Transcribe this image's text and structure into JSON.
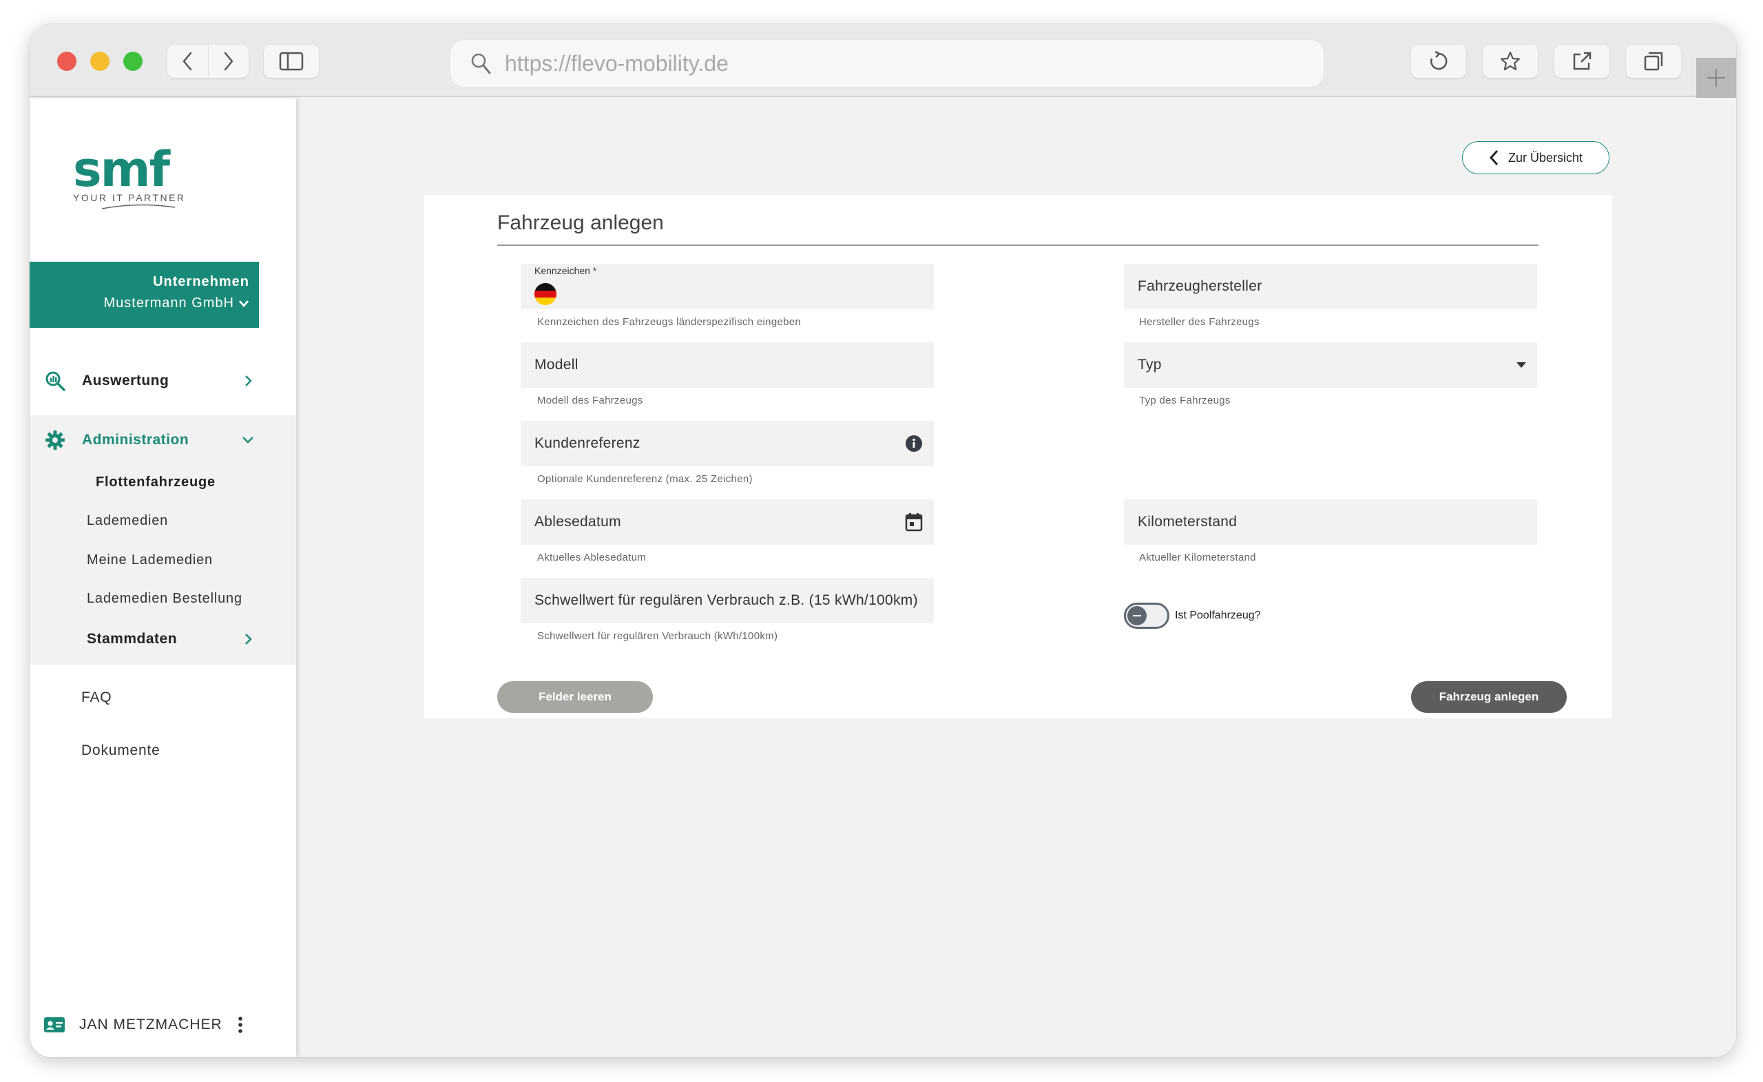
{
  "browser": {
    "url": "https://flevo-mobility.de"
  },
  "brand": {
    "logo_text": "smf",
    "tagline": "YOUR IT PARTNER",
    "accent_color": "#1a8a78"
  },
  "company": {
    "label": "Unternehmen",
    "name": "Mustermann GmbH"
  },
  "sidebar": {
    "auswertung": "Auswertung",
    "administration": "Administration",
    "admin_items": [
      "Flottenfahrzeuge",
      "Lademedien",
      "Meine Lademedien",
      "Lademedien Bestellung"
    ],
    "stammdaten": "Stammdaten",
    "faq": "FAQ",
    "dokumente": "Dokumente",
    "user_name": "JAN METZMACHER"
  },
  "header": {
    "back_label": "Zur Übersicht"
  },
  "form": {
    "title": "Fahrzeug anlegen",
    "kennzeichen_label": "Kennzeichen *",
    "kennzeichen_hint": "Kennzeichen des Fahrzeugs länderspezifisch eingeben",
    "hersteller_ph": "Fahrzeughersteller",
    "hersteller_hint": "Hersteller des Fahrzeugs",
    "modell_ph": "Modell",
    "modell_hint": "Modell des Fahrzeugs",
    "typ_ph": "Typ",
    "typ_hint": "Typ des Fahrzeugs",
    "kundenref_ph": "Kundenreferenz",
    "kundenref_hint": "Optionale Kundenreferenz (max. 25 Zeichen)",
    "ablesedatum_ph": "Ablesedatum",
    "ablesedatum_hint": "Aktuelles Ablesedatum",
    "km_ph": "Kilometerstand",
    "km_hint": "Aktueller Kilometerstand",
    "schwellwert_ph": "Schwellwert für regulären Verbrauch z.B. (15 kWh/100km)",
    "schwellwert_hint": "Schwellwert für regulären Verbrauch (kWh/100km)",
    "pool_label": "Ist Poolfahrzeug?",
    "clear_label": "Felder leeren",
    "submit_label": "Fahrzeug anlegen"
  }
}
